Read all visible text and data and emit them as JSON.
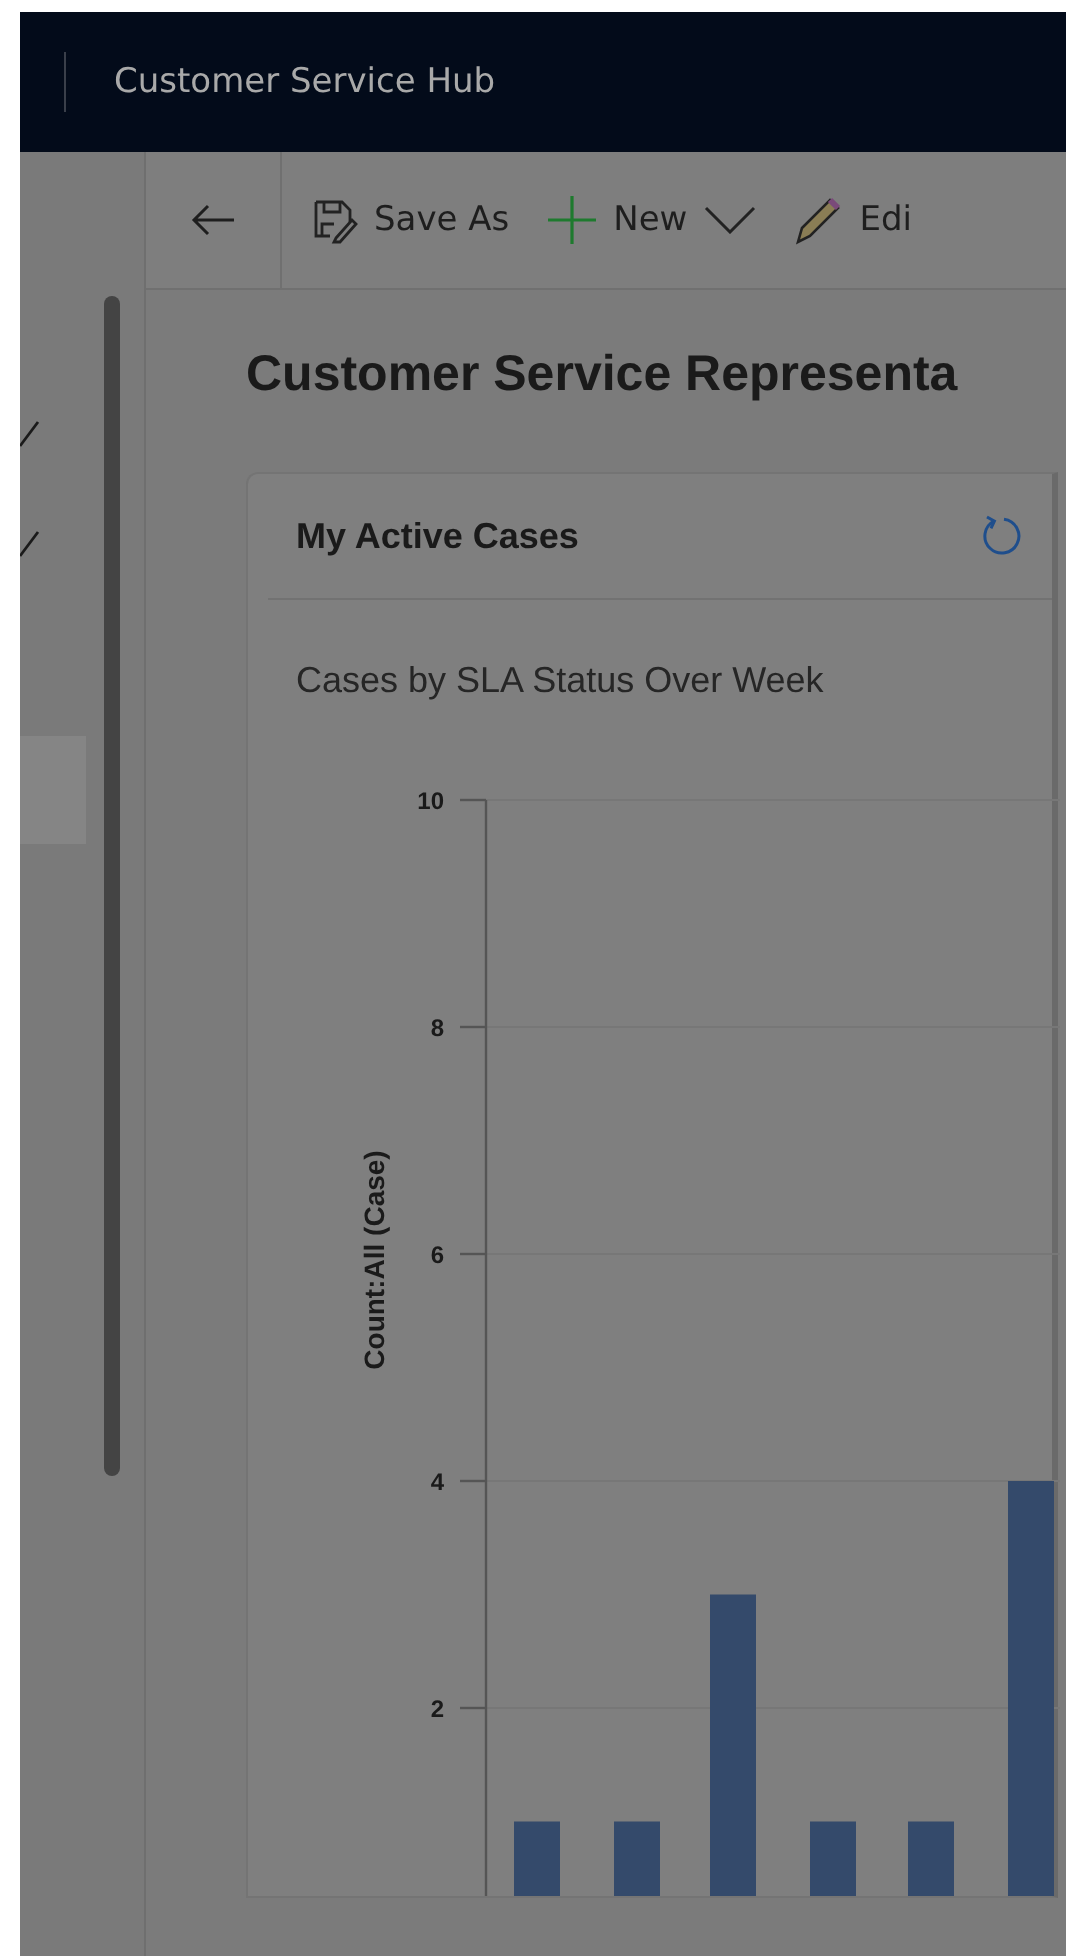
{
  "top_bar": {
    "app_title": "Customer Service Hub"
  },
  "command_bar": {
    "buttons": [
      {
        "kind": "save",
        "label": "Save As"
      },
      {
        "kind": "new",
        "label": "New"
      },
      {
        "kind": "dropdown"
      },
      {
        "kind": "edit",
        "label": "Edi"
      }
    ]
  },
  "page_title": "Customer Service Representa",
  "card": {
    "title": "My Active Cases",
    "chart_title": "Cases by SLA Status Over Week",
    "chart_data": {
      "type": "bar",
      "ylabel": "Count:All (Case)",
      "yticks": [
        2,
        4,
        6,
        8,
        10
      ],
      "ylim": [
        0,
        10
      ],
      "grid": true,
      "series": [
        {
          "color": "#344a6b",
          "values": [
            1,
            1,
            3,
            1,
            1,
            4
          ]
        }
      ]
    }
  }
}
